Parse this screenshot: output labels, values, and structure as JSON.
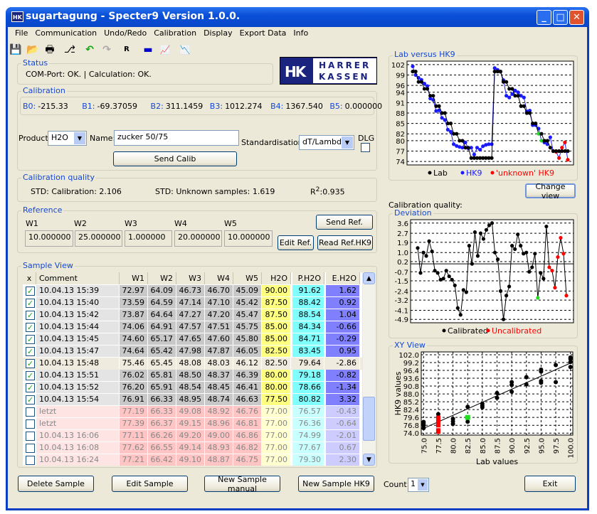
{
  "window": {
    "title": "sugartagung - Specter9   Version 1.0.0.",
    "app_icon": "HK",
    "min": "_",
    "max": "□",
    "close": "✕"
  },
  "menu": [
    "File",
    "Communication",
    "Undo/Redo",
    "Calibration",
    "Display",
    "Export Data",
    "Info"
  ],
  "toolbar": [
    {
      "icon": "save-icon",
      "glyph": "💾"
    },
    {
      "icon": "open-folder-icon",
      "glyph": "📂"
    },
    {
      "icon": "print-icon",
      "glyph": "🖶"
    },
    {
      "icon": "connect-icon",
      "glyph": "⎇"
    },
    {
      "icon": "undo-icon",
      "glyph": "↶"
    },
    {
      "icon": "redo-icon",
      "glyph": "↷"
    },
    {
      "icon": "reference-icon",
      "glyph": "R"
    },
    {
      "icon": "monitor-icon",
      "glyph": "▬"
    },
    {
      "icon": "chart-icon",
      "glyph": "📈"
    },
    {
      "icon": "chart-down-icon",
      "glyph": "📉"
    }
  ],
  "status": {
    "label": "Status",
    "text": "COM-Port: OK.  |   Calculation: OK."
  },
  "logo": {
    "mark": "HK",
    "line1": "HARRER",
    "line2": "KASSEN"
  },
  "calibration": {
    "label": "Calibration",
    "coeffs": [
      {
        "k": "B0:",
        "v": "-215.33"
      },
      {
        "k": "B1:",
        "v": "-69.37059"
      },
      {
        "k": "B2:",
        "v": "311.1459"
      },
      {
        "k": "B3:",
        "v": "1012.274"
      },
      {
        "k": "B4:",
        "v": "1367.540"
      },
      {
        "k": "B5:",
        "v": "0.000000"
      }
    ],
    "product_label": "Product:",
    "product": "H2O",
    "name_label": "Name:",
    "name": "zucker 50/75",
    "standardisation_label": "Standardisation:",
    "standardisation": "dT/Lambda",
    "dlg_label": "DLG",
    "send_calib": "Send Calib"
  },
  "quality": {
    "label": "Calibration quality",
    "std_cal": "STD: Calibration: 2.106",
    "std_unknown": "STD: Unknown samples: 1.619",
    "r2_prefix": "R",
    "r2_sup": "2",
    "r2_value": ":0.935"
  },
  "reference": {
    "label": "Reference",
    "cols": [
      "W1",
      "W2",
      "W3",
      "W4",
      "W5"
    ],
    "values": [
      "10.000000",
      "25.000000",
      "1.000000",
      "20.000000",
      "10.000000"
    ],
    "send_ref": "Send Ref.",
    "edit_ref": "Edit Ref.",
    "read_ref": "Read Ref.HK9"
  },
  "samples": {
    "label": "Sample View",
    "headers": [
      "x",
      "Comment",
      "W1",
      "W2",
      "W3",
      "W4",
      "W5",
      "H2O",
      "P.H2O",
      "E.H2O"
    ],
    "rows": [
      {
        "checked": true,
        "c": "10.04.13 15:39",
        "v": [
          "72.97",
          "64.09",
          "46.73",
          "46.70",
          "45.09",
          "90.00",
          "91.62",
          "1.62"
        ]
      },
      {
        "checked": true,
        "c": "10.04.13 15:40",
        "v": [
          "73.59",
          "64.59",
          "47.14",
          "47.10",
          "45.42",
          "87.50",
          "88.42",
          "0.92"
        ]
      },
      {
        "checked": true,
        "c": "10.04.13 15:42",
        "v": [
          "73.87",
          "64.64",
          "47.27",
          "47.20",
          "45.47",
          "87.50",
          "88.54",
          "1.04"
        ]
      },
      {
        "checked": true,
        "c": "10.04.13 15:44",
        "v": [
          "74.06",
          "64.91",
          "47.57",
          "47.51",
          "45.75",
          "85.00",
          "84.34",
          "-0.66"
        ]
      },
      {
        "checked": true,
        "c": "10.04.13 15:45",
        "v": [
          "74.60",
          "65.17",
          "47.65",
          "47.60",
          "45.80",
          "85.00",
          "84.71",
          "-0.29"
        ]
      },
      {
        "checked": true,
        "c": "10.04.13 15:47",
        "v": [
          "74.64",
          "65.42",
          "47.98",
          "47.87",
          "46.05",
          "82.50",
          "83.45",
          "0.95"
        ]
      },
      {
        "checked": true,
        "selected": true,
        "c": "10.04.13 15:48",
        "v": [
          "75.46",
          "65.45",
          "48.08",
          "48.03",
          "46.12",
          "82.50",
          "79.64",
          "-2.86"
        ]
      },
      {
        "checked": true,
        "c": "10.04.13 15:51",
        "v": [
          "76.02",
          "65.81",
          "48.50",
          "48.37",
          "46.39",
          "80.00",
          "79.18",
          "-0.82"
        ]
      },
      {
        "checked": true,
        "c": "10.04.13 15:52",
        "v": [
          "76.20",
          "65.91",
          "48.54",
          "48.45",
          "46.41",
          "80.00",
          "78.66",
          "-1.34"
        ]
      },
      {
        "checked": true,
        "c": "10.04.13 15:54",
        "v": [
          "76.91",
          "66.33",
          "48.95",
          "48.74",
          "46.63",
          "77.50",
          "80.82",
          "3.32"
        ]
      },
      {
        "checked": false,
        "c": "letzt",
        "v": [
          "77.19",
          "66.33",
          "49.08",
          "48.92",
          "46.76",
          "77.00",
          "76.57",
          "-0.43"
        ]
      },
      {
        "checked": false,
        "c": "letzt",
        "v": [
          "77.39",
          "66.37",
          "49.15",
          "48.96",
          "46.81",
          "77.00",
          "76.36",
          "-0.64"
        ]
      },
      {
        "checked": false,
        "c": "10.04.13 16:06",
        "v": [
          "77.11",
          "66.26",
          "49.20",
          "49.00",
          "46.86",
          "77.00",
          "74.99",
          "-2.01"
        ]
      },
      {
        "checked": false,
        "c": "10.04.13 16:08",
        "v": [
          "77.62",
          "66.55",
          "49.14",
          "48.93",
          "46.82",
          "77.00",
          "77.67",
          "0.67"
        ]
      },
      {
        "checked": false,
        "c": "10.04.13 16:24",
        "v": [
          "77.21",
          "66.42",
          "49.10",
          "48.87",
          "46.75",
          "77.00",
          "79.30",
          "2.30"
        ]
      }
    ]
  },
  "buttons": {
    "delete": "Delete Sample",
    "edit": "Edit Sample",
    "new_manual": "New Sample manual",
    "new_hk9": "New Sample HK9",
    "count_label": "Count:",
    "count": "1",
    "exit": "Exit",
    "change_view": "Change view"
  },
  "right": {
    "calib_quality_label": "Calibration quality:"
  },
  "colors": {
    "lab": "#000000",
    "hk9": "#1a1aff",
    "unknown": "#ff0000",
    "highlight": "#22dd22",
    "h2o": "#ffff80",
    "ph2o": "#80ffff",
    "eh2o": "#8080ff"
  },
  "chart_data": [
    {
      "type": "line",
      "title": "Lab versus HK9",
      "ylim": [
        73,
        103
      ],
      "yticks": [
        "102",
        "99",
        "96",
        "94",
        "91",
        "88",
        "85",
        "82",
        "80",
        "77",
        "74"
      ],
      "grid": true,
      "legend": "bottom",
      "series": [
        {
          "name": "Lab",
          "values": [
            100,
            100,
            97,
            97,
            95,
            95,
            93,
            93,
            90,
            90,
            88,
            88,
            85,
            85,
            82,
            82,
            80,
            80,
            78,
            78,
            75,
            75,
            75,
            75,
            75,
            75,
            75,
            75,
            100,
            100,
            100,
            97,
            97,
            95,
            95,
            93,
            93,
            90,
            90,
            88,
            88,
            85,
            85,
            82,
            82,
            80,
            80,
            78,
            77,
            77,
            77,
            77,
            77,
            77
          ]
        },
        {
          "name": "HK9",
          "values": [
            101.5,
            99,
            98.2,
            97.6,
            96.5,
            95.8,
            92.2,
            91.8,
            88.6,
            88.8,
            86.6,
            86,
            83.2,
            82.6,
            79,
            78.5,
            78.2,
            78,
            79.5,
            77.8,
            78,
            76,
            78,
            77.4,
            78.4,
            78.8,
            79,
            79,
            101,
            100.5,
            100,
            97.5,
            93,
            92.5,
            93.5,
            94.5,
            94,
            93,
            92.5,
            88.5,
            88.7,
            84.5,
            84.5,
            83.5,
            80,
            79.5,
            79,
            81,
            77,
            76.8,
            75,
            78,
            79.5,
            74.5
          ]
        },
        {
          "name": "'unknown' HK9",
          "from_index": 48
        }
      ],
      "highlight_index": 44
    },
    {
      "type": "line",
      "title": "Deviation",
      "ylim": [
        -5.2,
        3.9
      ],
      "yticks": [
        "3.6",
        "2.7",
        "1.9",
        "1.0",
        "0.2",
        "-0.7",
        "-1.5",
        "-2.4",
        "-3.2",
        "-4.1",
        "-4.9"
      ],
      "grid": true,
      "legend": "bottom",
      "series": [
        {
          "name": "Calibrated",
          "values": [
            1.4,
            -0.8,
            1.0,
            0.7,
            2.0,
            1.1,
            -0.6,
            -0.8,
            -1.4,
            -1.3,
            -0.6,
            -1.1,
            -1.4,
            -1.9,
            -3.9,
            -4.5,
            -2.3,
            -2.5,
            1.6,
            0,
            2.8,
            0.7,
            2.7,
            2.2,
            3.0,
            3.4,
            3.6,
            1.0,
            0.4,
            -2.4,
            -4.9,
            -2.8,
            -2.0,
            1.6,
            1.3,
            2.6,
            1.6,
            0.9,
            1.0,
            -0.7,
            -0.3,
            0.9,
            -3.0,
            -0.8,
            -1.3,
            3.3,
            -0.3,
            -0.6,
            -2.1,
            0.6,
            2.3,
            0.9,
            -2.8
          ]
        },
        {
          "name": "Uncalibrated",
          "from_index": 46
        }
      ],
      "highlight_index": 42
    },
    {
      "type": "scatter",
      "title": "XY View",
      "xlabel": "Lab values",
      "ylabel": "HK9 values",
      "xlim": [
        74.6,
        100.4
      ],
      "ylim": [
        73.3,
        103
      ],
      "xticks": [
        "75.0",
        "77.5",
        "80.0",
        "82.5",
        "85.0",
        "87.5",
        "90.0",
        "92.5",
        "95.0",
        "97.5",
        "100.0"
      ],
      "yticks": [
        "102.0",
        "99.2",
        "96.4",
        "93.6",
        "90.8",
        "88.0",
        "85.2",
        "82.4",
        "79.6",
        "76.8",
        "74.0"
      ],
      "grid": true,
      "points": [
        [
          75,
          78
        ],
        [
          75,
          77.5
        ],
        [
          75,
          76.8
        ],
        [
          75,
          75.8
        ],
        [
          77.5,
          80.8
        ],
        [
          77.5,
          78.9
        ],
        [
          77.5,
          77.2
        ],
        [
          80,
          79.1
        ],
        [
          80,
          78.2
        ],
        [
          80,
          77.3
        ],
        [
          82.5,
          83.4
        ],
        [
          82.5,
          78.1
        ],
        [
          85,
          84.5
        ],
        [
          85,
          83.8
        ],
        [
          85,
          83.2
        ],
        [
          87.5,
          88.3
        ],
        [
          87.5,
          86.6
        ],
        [
          90,
          92.2
        ],
        [
          90,
          91.2
        ],
        [
          90,
          88.8
        ],
        [
          92.5,
          94.0
        ],
        [
          92.5,
          91.4
        ],
        [
          95,
          96.7
        ],
        [
          95,
          96.0
        ],
        [
          95,
          92.6
        ],
        [
          95,
          92.0
        ],
        [
          97.5,
          98.3
        ],
        [
          97.5,
          92.2
        ],
        [
          100,
          101.0
        ],
        [
          100,
          100.5
        ],
        [
          100,
          99.4
        ],
        [
          100,
          97.6
        ]
      ],
      "unknown_points": [
        [
          77.5,
          79.5
        ],
        [
          77.5,
          78.4
        ],
        [
          77.5,
          77.0
        ],
        [
          77.5,
          76.8
        ],
        [
          77.5,
          75.0
        ],
        [
          77.5,
          74.5
        ]
      ],
      "highlight_point": [
        82.5,
        79.6
      ],
      "fit_line": [
        [
          75,
          75.7
        ],
        [
          100,
          99.0
        ]
      ]
    }
  ]
}
